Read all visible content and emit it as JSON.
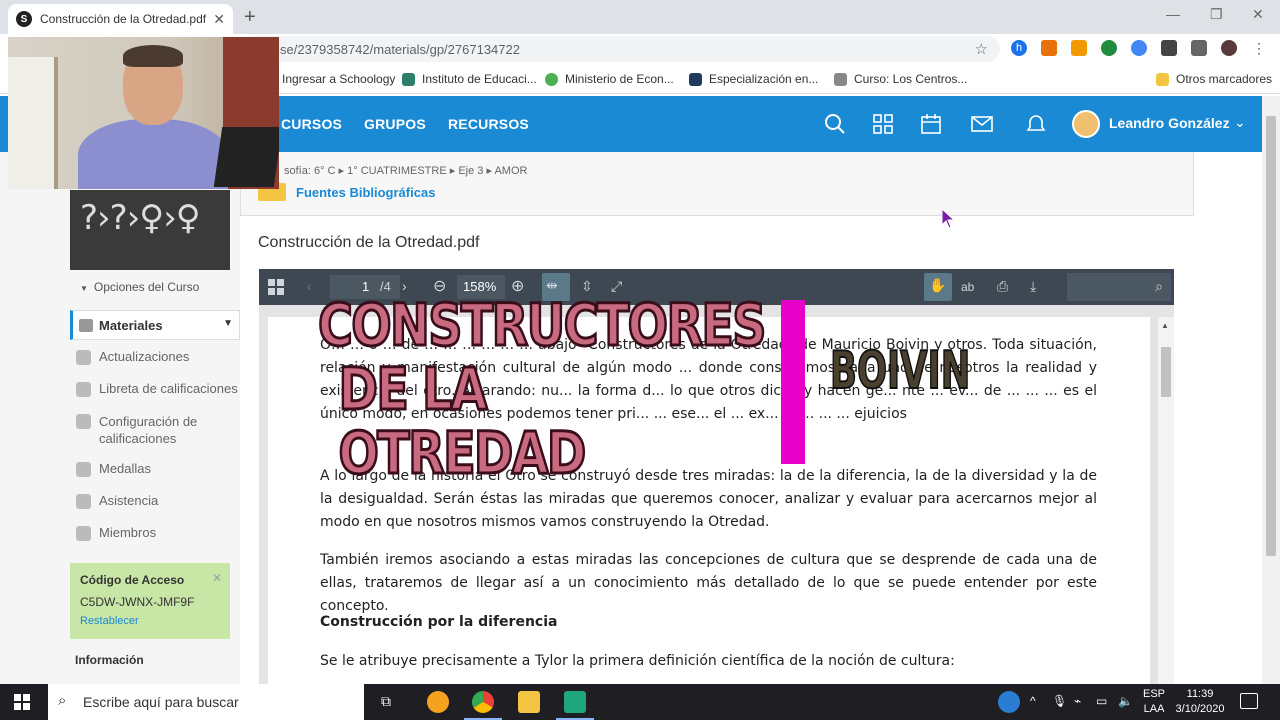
{
  "browser": {
    "tab_title": "Construcción de la Otredad.pdf |",
    "tab_favicon_letter": "S",
    "url": "se/2379358742/materials/gp/2767134722",
    "bookmarks": [
      {
        "label": "Ingresar a Schoology",
        "color": "#1a8ad4"
      },
      {
        "label": "Instituto de Educaci...",
        "color": "#2e7d6a"
      },
      {
        "label": "Ministerio de Econ...",
        "color": "#4caf50"
      },
      {
        "label": "Especialización en...",
        "color": "#1e3a5f"
      },
      {
        "label": "Curso: Los Centros...",
        "color": "#888888"
      }
    ],
    "other_bookmarks": "Otros marcadores"
  },
  "header": {
    "nav": [
      "CURSOS",
      "GRUPOS",
      "RECURSOS"
    ],
    "user_name": "Leandro González",
    "accent": "#1a8ad4"
  },
  "sidebar": {
    "course_options": "Opciones del Curso",
    "active_item": "Materiales",
    "items": [
      "Actualizaciones",
      "Libreta de calificaciones",
      "Configuración de calificaciones",
      "Medallas",
      "Asistencia",
      "Miembros"
    ],
    "access_code": {
      "title": "Código de Acceso",
      "code": "C5DW-JWNX-JMF9F",
      "reset": "Restablecer"
    },
    "info_heading": "Información"
  },
  "breadcrumb": [
    "sofía: 6° C",
    "1° CUATRIMESTRE",
    "Eje 3",
    "AMOR"
  ],
  "folder_name": "Fuentes Bibliográficas",
  "document_title": "Construcción de la Otredad.pdf",
  "pdf": {
    "page_current": "1",
    "page_total": "/4",
    "zoom": "158%",
    "text_icon": "ab",
    "paragraphs": [
      "O… … ó … de … … … … … … abajo \"Constructores de la Otredad\" de Mauricio Boivin y otros. Toda situación, relación y manifestación cultural de algún modo ... donde construimos cada uno de nosotros la realidad y existencia del otro. Aclarando: nu... la forma d... lo que otros dicen y hacen ge... nte ... ev... de ... ... ... es el único modo, en ocasiones podemos tener pri... ... ese... el ... ex... ... ... ... ... ejuicios",
      "A lo largo de la historia el Otro se construyó desde tres miradas: la de la diferencia, la de la diversidad y la de la desigualdad. Serán éstas las miradas que queremos conocer, analizar y evaluar para acercarnos mejor al modo en que nosotros mismos vamos construyendo la Otredad.",
      "También iremos asociando a estas miradas las concepciones de cultura que se desprende de cada una de ellas, trataremos de llegar así a un conocimiento más detallado de lo que se puede entender por este concepto.",
      "Construcción por la diferencia",
      "Se le atribuye precisamente a Tylor la primera definición científica de la noción de cultura:"
    ]
  },
  "overlay": {
    "title_line1": "CONSTRUCTORES",
    "title_line2": "DE LA OTREDAD",
    "name": "BOIVIN",
    "bar_color": "#e600c8"
  },
  "taskbar": {
    "search_placeholder": "Escribe aquí para buscar",
    "lang_line1": "ESP",
    "lang_line2": "LAA",
    "time": "11:39",
    "date": "3/10/2020"
  }
}
